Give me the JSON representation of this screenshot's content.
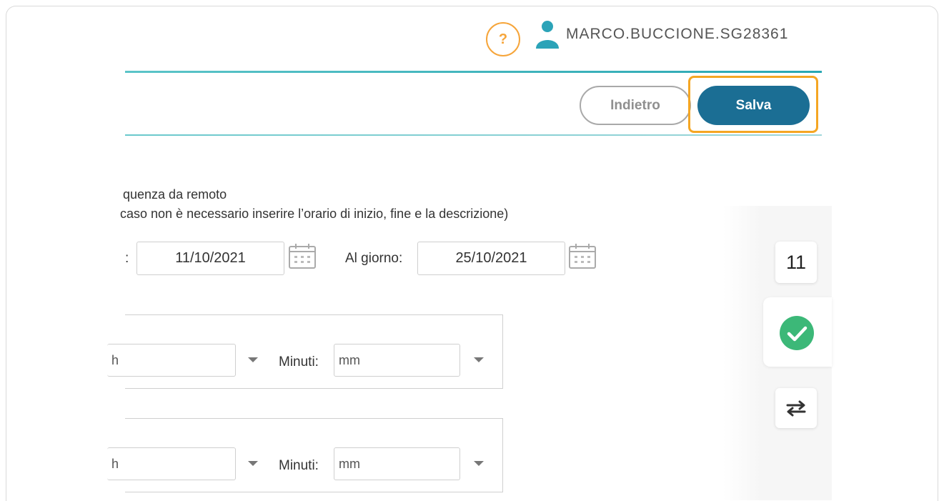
{
  "header": {
    "help_label": "?",
    "username": "MARCO.BUCCIONE.SG28361"
  },
  "toolbar": {
    "back_label": "Indietro",
    "save_label": "Salva"
  },
  "form": {
    "line1": "quenza da remoto",
    "line2": "caso non è necessario inserire l’orario di inizio, fine e la descrizione)",
    "from_label_fragment": ":",
    "from_date": "11/10/2021",
    "to_label": "Al giorno:",
    "to_date": "25/10/2021",
    "start_time": {
      "hours_placeholder_fragment": "h",
      "minutes_label": "Minuti:",
      "minutes_placeholder": "mm"
    },
    "end_time": {
      "hours_placeholder_fragment": "h",
      "minutes_label": "Minuti:",
      "minutes_placeholder": "mm"
    }
  },
  "side_panel": {
    "day_number": "11"
  },
  "colors": {
    "accent_teal": "#1b6e94",
    "highlight_orange": "#f5a623",
    "help_orange": "#f6a53a",
    "success_green": "#3cb878"
  }
}
